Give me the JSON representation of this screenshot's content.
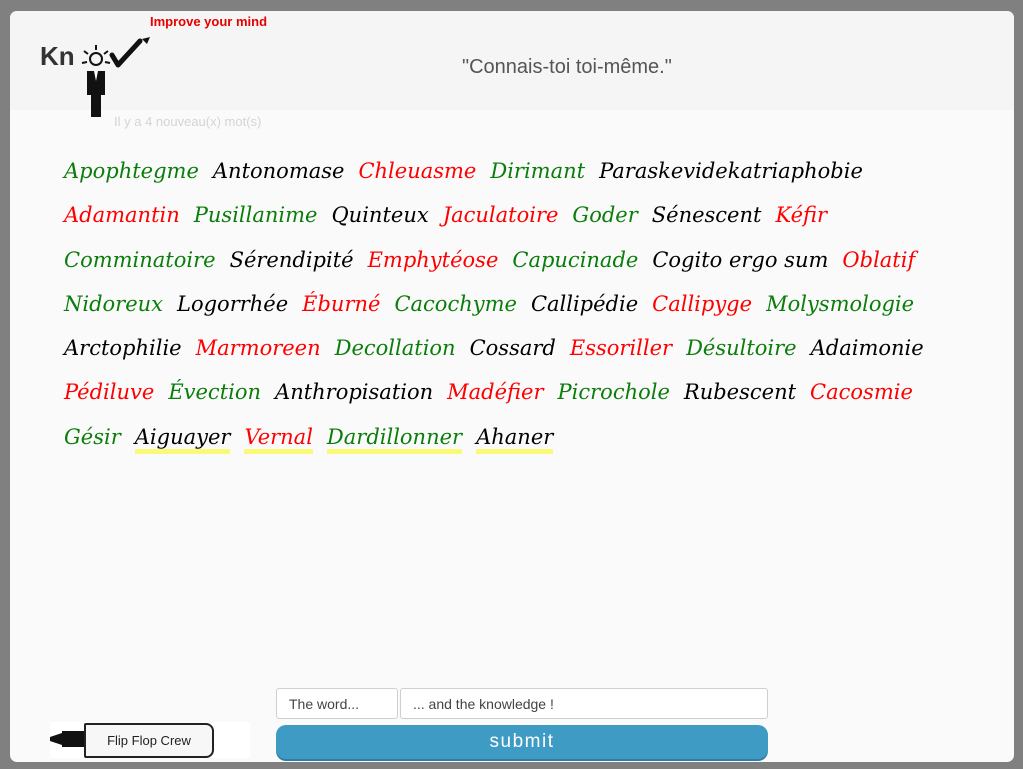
{
  "header": {
    "logo_text": "Kn",
    "tagline": "Improve your mind",
    "quote": "\"Connais-toi toi-même.\"",
    "new_words_notice": "Il y a 4 nouveau(x) mot(s)"
  },
  "colors": {
    "green": "#0a7d0a",
    "black": "#000000",
    "red": "#ff0000",
    "new_highlight": "#fafa78",
    "submit_bg": "#3d9bc4",
    "tagline": "#e60000"
  },
  "words": [
    {
      "text": "Apophtegme",
      "color": "green",
      "new": false
    },
    {
      "text": "Antonomase",
      "color": "black",
      "new": false
    },
    {
      "text": "Chleuasme",
      "color": "red",
      "new": false
    },
    {
      "text": "Dirimant",
      "color": "green",
      "new": false
    },
    {
      "text": "Paraskevidekatriaphobie",
      "color": "black",
      "new": false
    },
    {
      "text": "Adamantin",
      "color": "red",
      "new": false
    },
    {
      "text": "Pusillanime",
      "color": "green",
      "new": false
    },
    {
      "text": "Quinteux",
      "color": "black",
      "new": false
    },
    {
      "text": "Jaculatoire",
      "color": "red",
      "new": false
    },
    {
      "text": "Goder",
      "color": "green",
      "new": false
    },
    {
      "text": "Sénescent",
      "color": "black",
      "new": false
    },
    {
      "text": "Kéfir",
      "color": "red",
      "new": false
    },
    {
      "text": "Comminatoire",
      "color": "green",
      "new": false
    },
    {
      "text": "Sérendipité",
      "color": "black",
      "new": false
    },
    {
      "text": "Emphytéose",
      "color": "red",
      "new": false
    },
    {
      "text": "Capucinade",
      "color": "green",
      "new": false
    },
    {
      "text": "Cogito ergo sum",
      "color": "black",
      "new": false
    },
    {
      "text": "Oblatif",
      "color": "red",
      "new": false
    },
    {
      "text": "Nidoreux",
      "color": "green",
      "new": false
    },
    {
      "text": "Logorrhée",
      "color": "black",
      "new": false
    },
    {
      "text": "Éburné",
      "color": "red",
      "new": false
    },
    {
      "text": "Cacochyme",
      "color": "green",
      "new": false
    },
    {
      "text": "Callipédie",
      "color": "black",
      "new": false
    },
    {
      "text": "Callipyge",
      "color": "red",
      "new": false
    },
    {
      "text": "Molysmologie",
      "color": "green",
      "new": false
    },
    {
      "text": "Arctophilie",
      "color": "black",
      "new": false
    },
    {
      "text": "Marmoreen",
      "color": "red",
      "new": false
    },
    {
      "text": "Decollation",
      "color": "green",
      "new": false
    },
    {
      "text": "Cossard",
      "color": "black",
      "new": false
    },
    {
      "text": "Essoriller",
      "color": "red",
      "new": false
    },
    {
      "text": "Désultoire",
      "color": "green",
      "new": false
    },
    {
      "text": "Adaimonie",
      "color": "black",
      "new": false
    },
    {
      "text": "Pédiluve",
      "color": "red",
      "new": false
    },
    {
      "text": "Évection",
      "color": "green",
      "new": false
    },
    {
      "text": "Anthropisation",
      "color": "black",
      "new": false
    },
    {
      "text": "Madéfier",
      "color": "red",
      "new": false
    },
    {
      "text": "Picrochole",
      "color": "green",
      "new": false
    },
    {
      "text": "Rubescent",
      "color": "black",
      "new": false
    },
    {
      "text": "Cacosmie",
      "color": "red",
      "new": false
    },
    {
      "text": "Gésir",
      "color": "green",
      "new": false
    },
    {
      "text": "Aiguayer",
      "color": "black",
      "new": true
    },
    {
      "text": "Vernal",
      "color": "red",
      "new": true
    },
    {
      "text": "Dardillonner",
      "color": "green",
      "new": true
    },
    {
      "text": "Ahaner",
      "color": "black",
      "new": true
    }
  ],
  "form": {
    "word_placeholder": "The word...",
    "knowledge_placeholder": "... and the knowledge !",
    "submit_label": "submit"
  },
  "footer": {
    "crew_label": "Flip Flop Crew"
  },
  "icons": {
    "logo": "lightbulb-person-check-icon",
    "marker": "marker-pen-icon"
  }
}
